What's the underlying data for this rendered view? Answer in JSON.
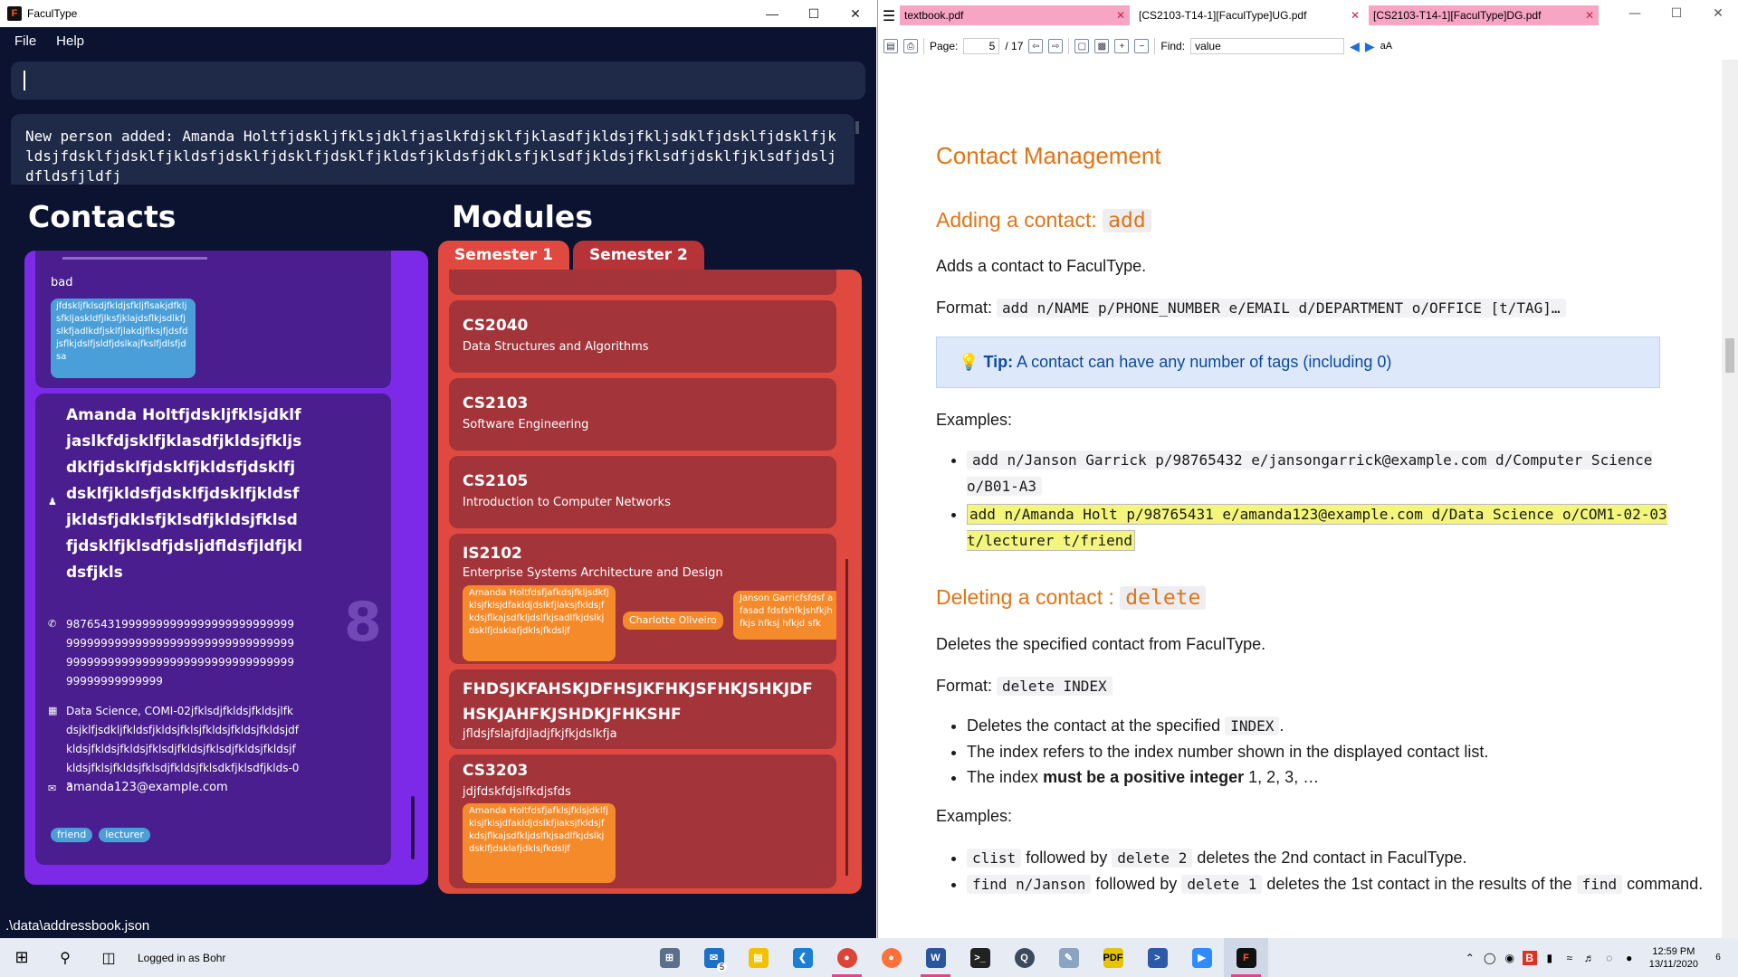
{
  "faculType": {
    "title": "FaculType",
    "menu": [
      "File",
      "Help"
    ],
    "command_value": "",
    "result_text": "New person added: Amanda Holtfjdskljfklsjdklfjaslkfdjsklfjklasdfjkldsjfkljsdklfjdsklfjdsklfjkldsjfdsklfjdsklfjkldsfjdsklfjdsklfjdsklfjkldsfjkldsfjdklsfjklsdfjkldsjfklsdfjdsklfjklsdfjdsljdfldsfjldfj",
    "contacts_title": "Contacts",
    "modules_title": "Modules",
    "prev_contact": {
      "department_fragment": "bad",
      "tag": "jfdskljfklsdjfkldjsfkljflsakjdfkljsfkljaskldfjlksfjklajdsflkjsdlkfjslkfjadlkdfjsklfjlakdjflksjfjdsfdjsflkjdslfjsldfjdslkajfkslfjdlsfjdsa"
    },
    "contact": {
      "name": "Amanda Holtfjdskljfklsjdklfjaslkfdjsklfjklasdfjkldsjfkljsdklfjdsklfjdsklfjkldsfjdsklfjdsklfjkldsfjdsklfjdsklfjkldsfjkldsfjdklsfjklsdfjkldsjfklsdfjdsklfjklsdfjdsljdfldsfjldfjkldsfjkls",
      "phone": "98765431999999999999999999999999999999999999999999999999999999999999999999999999999999999999999999999999999999999",
      "office": "Data Science, COMI-02jfklsdjfkldsjfkldsjlfkdsjklfjsdkljfkldsfjkldsjfklsjfkldsjfkldsjfkldsjdfkldsjfkldsjfkldsjfklsdjfkldsjfklsdjfkldsjfkldsjfkldsjfklsjfkldsjfklsdjfkldsjfklsdkfjklsdfjklds-03",
      "email": "amanda123@example.com",
      "index": "8",
      "tags": [
        "friend",
        "lecturer"
      ]
    },
    "semester_tabs": [
      "Semester 1",
      "Semester 2"
    ],
    "modules": [
      {
        "code": "CS2040",
        "name": "Data Structures and Algorithms"
      },
      {
        "code": "CS2103",
        "name": "Software Engineering"
      },
      {
        "code": "CS2105",
        "name": "Introduction to Computer Networks"
      },
      {
        "code": "IS2102",
        "name": "Enterprise Systems Architecture and Design",
        "instructors": [
          "Amanda Holtfdsfjafkdsjfkljsdkfjklsjfklsjdfakldjdslkfjlaksjfkldsjfkdsjflkajsdfkljdslfkjsadlfkjdslkjdsklfjdsklafjdklsjfkdsljf",
          "Charlotte Oliveiro",
          "Janson Garricfsfdsf afasad fdsfshfkjshfkjhfkjs hfksj hfkjd sfk"
        ]
      },
      {
        "code": "FHDSJKFAHSKJDFHSJKFHKJSFHKJSHKJDFHSKJAHFKJSHDKJFHKSHF",
        "name": "jfldsjfslajfdjladjfkjfkjdslkfja"
      },
      {
        "code": "CS3203",
        "name": "jdjfdskfdjslfkdjsfds",
        "instructors": [
          "Amanda Holtfdsfjafklsjfklsjdklfjklsjfklsjdfakldjdslkfjlaksjfkldsjfkdsjflkajsdfkljdslfkjsadlfkjdslkjdsklfjdsklafjdklsjfkdsljf"
        ]
      }
    ],
    "status_path": ".\\data\\addressbook.json"
  },
  "pdf": {
    "tabs": [
      {
        "label": "textbook.pdf",
        "style": "pink"
      },
      {
        "label": "[CS2103-T14-1][FaculType]UG.pdf",
        "style": "white"
      },
      {
        "label": "[CS2103-T14-1][FaculType]DG.pdf",
        "style": "pink"
      }
    ],
    "page_label": "Page:",
    "page_current": "5",
    "page_total": "/ 17",
    "find_label": "Find:",
    "find_value": "value",
    "content": {
      "h1": "Contact Management",
      "add_heading": "Adding a contact:",
      "add_cmd": "add",
      "add_desc": "Adds a contact to FaculType.",
      "format_label": "Format:",
      "add_format": "add n/NAME p/PHONE_NUMBER e/EMAIL d/DEPARTMENT o/OFFICE [t/TAG]…",
      "tip_label": "Tip:",
      "tip_text": "A contact can have any number of tags (including 0)",
      "examples_label": "Examples:",
      "add_example_1": "add n/Janson Garrick p/98765432 e/jansongarrick@example.com d/Computer Science o/B01-A3",
      "add_example_2": "add n/Amanda Holt p/98765431 e/amanda123@example.com d/Data Science o/COM1-02-03 t/lecturer t/friend",
      "delete_heading": "Deleting a contact :",
      "delete_cmd": "delete",
      "delete_desc": "Deletes the specified contact from FaculType.",
      "delete_format": "delete INDEX",
      "delete_bullet_1_a": "Deletes the contact at the specified",
      "delete_bullet_1_code": "INDEX",
      "delete_bullet_1_b": ".",
      "delete_bullet_2": "The index refers to the index number shown in the displayed contact list.",
      "delete_bullet_3_a": "The index",
      "delete_bullet_3_bold": "must be a positive integer",
      "delete_bullet_3_b": "1, 2, 3, …",
      "del_ex1_code1": "clist",
      "del_ex1_mid": "followed by",
      "del_ex1_code2": "delete 2",
      "del_ex1_end": "deletes the 2nd contact in FaculType.",
      "del_ex2_code1": "find n/Janson",
      "del_ex2_mid": "followed by",
      "del_ex2_code2": "delete 1",
      "del_ex2_end": "deletes the 1st contact in the results of the",
      "del_ex2_code3": "find",
      "del_ex2_tail": "command."
    }
  },
  "taskbar": {
    "login_text": "Logged in as Bohr",
    "mail_badge": "5",
    "time": "12:59 PM",
    "date": "13/11/2020",
    "notif_count": "6"
  },
  "colors": {
    "faculType_bg": "#0b1330",
    "contacts_panel": "#7d2ae8",
    "contact_card": "#4a1e8e",
    "modules_panel": "#e0493f",
    "module_card": "#a3343a",
    "tag_blue": "#4a9fd8",
    "tag_orange": "#f58a2a",
    "pdf_heading": "#e07415",
    "tip_bg": "#dde9fb"
  }
}
